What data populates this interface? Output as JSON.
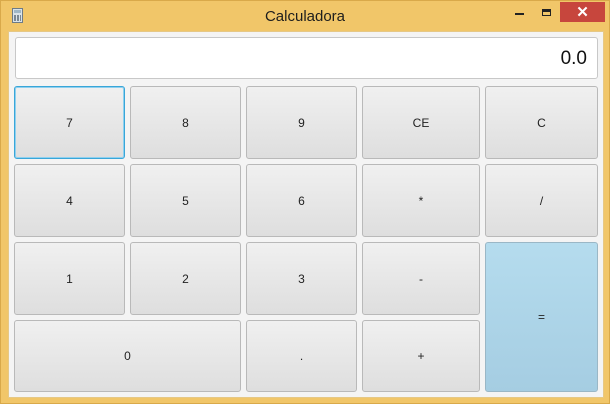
{
  "window": {
    "title": "Calculadora",
    "controls": {
      "minimize": "",
      "maximize": "",
      "close": "✕"
    }
  },
  "display": {
    "value": "0.0"
  },
  "keys": {
    "k7": "7",
    "k8": "8",
    "k9": "9",
    "ce": "CE",
    "c": "C",
    "k4": "4",
    "k5": "5",
    "k6": "6",
    "mul": "*",
    "div": "/",
    "k1": "1",
    "k2": "2",
    "k3": "3",
    "sub": "-",
    "k0": "0",
    "dot": ".",
    "add": "+",
    "eq": "="
  },
  "colors": {
    "frame": "#f1c669",
    "close": "#c7463d",
    "equals": "#a9d1e6",
    "focus": "#39a6d8"
  }
}
